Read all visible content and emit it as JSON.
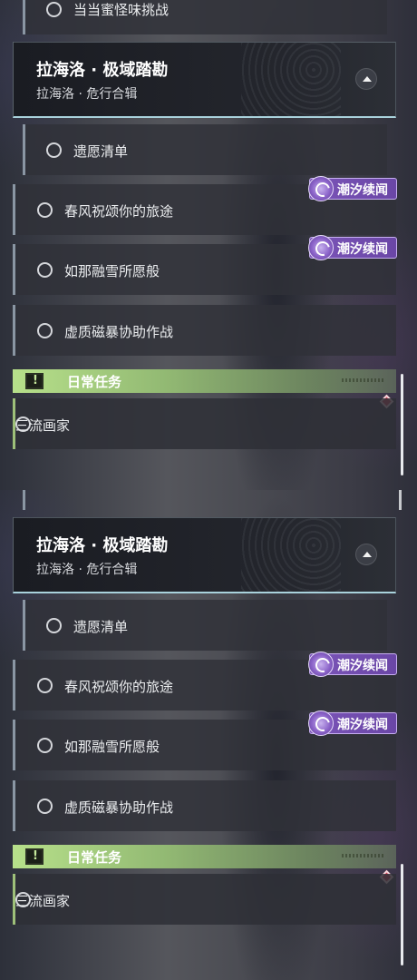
{
  "top_panel": {
    "partial_quest": {
      "label": "当当蜜怪味挑战"
    },
    "section": {
      "title": "拉海洛 · 极域踏勘",
      "subtitle": "拉海洛 · 危行合辑"
    },
    "quests": [
      {
        "label": "遗愿清单"
      },
      {
        "label": "春风祝颂你的旅途",
        "tag": "潮汐续闻"
      },
      {
        "label": "如那融雪所愿般",
        "tag": "潮汐续闻"
      },
      {
        "label": "虚质磁暴协助作战"
      }
    ],
    "daily": {
      "label": "日常任务",
      "quest": "三流画家"
    }
  },
  "bottom_panel": {
    "section": {
      "title": "拉海洛 · 极域踏勘",
      "subtitle": "拉海洛 · 危行合辑"
    },
    "quests": [
      {
        "label": "遗愿清单"
      },
      {
        "label": "春风祝颂你的旅途",
        "tag": "潮汐续闻"
      },
      {
        "label": "如那融雪所愿般",
        "tag": "潮汐续闻"
      },
      {
        "label": "虚质磁暴协助作战"
      }
    ],
    "daily": {
      "label": "日常任务",
      "quest": "三流画家"
    }
  },
  "colors": {
    "daily_accent": "#b7e08a",
    "tag_purple": "#7b55b8",
    "header_underline": "#a9d2dc",
    "alert_red": "#d8425a"
  },
  "icons": {
    "collapse": "chevron-up-icon",
    "status": "circle-icon",
    "tag": "tide-emblem-icon",
    "daily": "exclamation-box-icon",
    "new": "red-diamond-icon"
  }
}
